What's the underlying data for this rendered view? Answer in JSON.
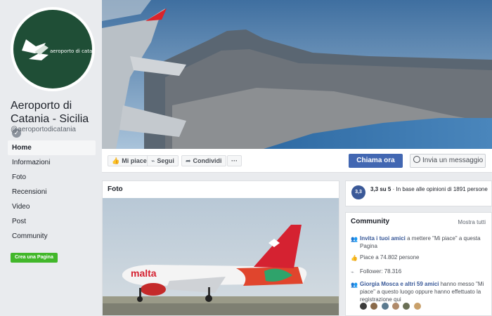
{
  "page": {
    "logo_text": "aeroporto di catania",
    "name": "Aeroporto di Catania - Sicilia",
    "handle": "@aeroportodicatania",
    "verified_icon": "check-icon"
  },
  "nav": {
    "items": [
      {
        "label": "Home",
        "active": true
      },
      {
        "label": "Informazioni"
      },
      {
        "label": "Foto"
      },
      {
        "label": "Recensioni"
      },
      {
        "label": "Video"
      },
      {
        "label": "Post"
      },
      {
        "label": "Community"
      }
    ],
    "create_page": "Crea una Pagina"
  },
  "actions": {
    "like": "Mi piace",
    "follow": "Segui",
    "share": "Condividi",
    "more": "···",
    "call": "Chiama ora",
    "message": "Invia un messaggio"
  },
  "photos": {
    "title": "Foto",
    "plane_livery": "malta"
  },
  "rating": {
    "badge": "3,3",
    "score": "3,3 su 5",
    "text": " ·  In base alle opinioni di 1891 persone"
  },
  "community": {
    "title": "Community",
    "see_all": "Mostra tutti",
    "invite_link": "Invita i tuoi amici",
    "invite_text": " a mettere \"Mi piace\" a questa Pagina",
    "likes": "Piace a 74.802 persone",
    "followers": "Follower: 78.316",
    "friends_link": "Giorgia Mosca e altri 59 amici",
    "friends_text": " hanno messo \"Mi piace\" a questo luogo oppure hanno effettuato la registrazione qui"
  },
  "colors": {
    "brand": "#4267b2",
    "logo_bg": "#1f4e36",
    "create_btn": "#42b72a"
  }
}
